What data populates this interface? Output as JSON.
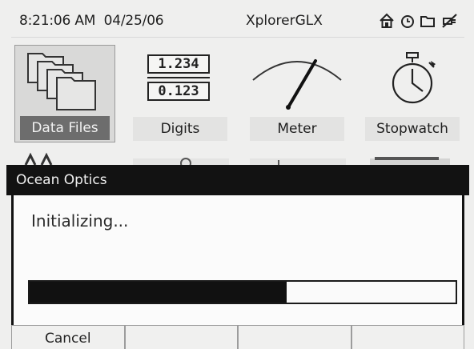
{
  "status_bar": {
    "time": "8:21:06 AM",
    "date": "04/25/06",
    "title": "XplorerGLX",
    "icons": [
      "home-icon",
      "clock-icon",
      "folder-icon",
      "no-power-icon"
    ]
  },
  "tiles": [
    {
      "label": "Data Files",
      "icon": "data-files-icon",
      "selected": true
    },
    {
      "label": "Digits",
      "icon": "digits-icon",
      "selected": false,
      "readouts": [
        "1.234",
        "0.123"
      ]
    },
    {
      "label": "Meter",
      "icon": "meter-icon",
      "selected": false
    },
    {
      "label": "Stopwatch",
      "icon": "stopwatch-icon",
      "selected": false
    }
  ],
  "dialog": {
    "title": "Ocean Optics",
    "message": "Initializing...",
    "progress": 0.604
  },
  "softkeys": [
    "Cancel",
    "",
    "",
    ""
  ],
  "colors": {
    "dialog_bar": "#121212",
    "selected_label": "#6d6d6d",
    "screen_bg": "#efefee"
  }
}
